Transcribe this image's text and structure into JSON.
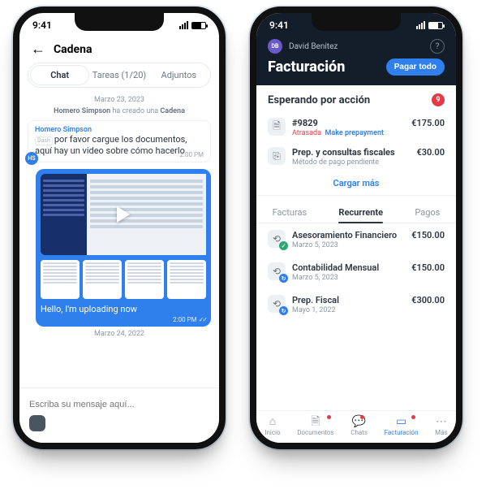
{
  "status": {
    "time": "9:41"
  },
  "phone1": {
    "title": "Cadena",
    "tabs": {
      "chat": "Chat",
      "tasks": "Tareas (1/20)",
      "attach": "Adjuntos"
    },
    "date1": "Marzo 23, 2023",
    "system_line_prefix": "Homero Simpson",
    "system_line_mid": " ha creado una ",
    "system_line_chain": "Cadena",
    "sender": "Homero Simpson",
    "dash_badge": "Dash",
    "in_text": "por favor cargue los documentos, aquí hay un video sobre cómo hacerlo",
    "in_time": "2:00 PM",
    "avatar": "HS",
    "out_text": "Hello, I'm uploading now",
    "out_time": "2:00 PM",
    "date2": "Marzo 24, 2022",
    "composer_placeholder": "Escriba su mensaje aquí..."
  },
  "phone2": {
    "user_initials": "DB",
    "user_name": "David Benitez",
    "title": "Facturación",
    "pay_all": "Pagar todo",
    "waiting": "Esperando por acción",
    "waiting_count": "9",
    "bill1": {
      "num": "#9829",
      "price": "€175.00",
      "late": "Atrasada",
      "link": "Make prepayment"
    },
    "bill2": {
      "name": "Prep. y consultas fiscales",
      "price": "€30.00",
      "sub": "Método de pago pendiente"
    },
    "load_more": "Cargar más",
    "tabs": {
      "facturas": "Facturas",
      "recurrente": "Recurrente",
      "pagos": "Pagos"
    },
    "rec1": {
      "name": "Asesoramiento Financiero",
      "price": "€150.00",
      "date": "Marzo 5, 2023"
    },
    "rec2": {
      "name": "Contabilidad Mensual",
      "price": "€150.00",
      "date": "Marzo 5, 2023"
    },
    "rec3": {
      "name": "Prep. Fiscal",
      "price": "€300.00",
      "date": "Mayo 1, 2022"
    },
    "nav": {
      "home": "Inicio",
      "docs": "Documentos",
      "chats": "Chats",
      "billing": "Facturación",
      "more": "Más"
    }
  }
}
